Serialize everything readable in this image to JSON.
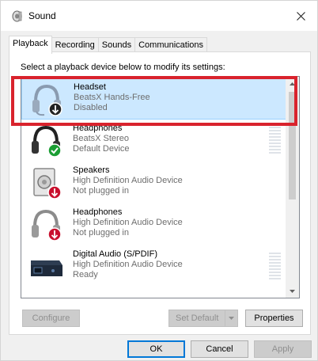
{
  "window": {
    "title": "Sound",
    "icon": "speaker-icon"
  },
  "tabs": [
    {
      "label": "Playback",
      "active": true
    },
    {
      "label": "Recording",
      "active": false
    },
    {
      "label": "Sounds",
      "active": false
    },
    {
      "label": "Communications",
      "active": false
    }
  ],
  "instructions": "Select a playback device below to modify its settings:",
  "devices": [
    {
      "name": "Headset",
      "line1": "BeatsX Hands-Free",
      "line2": "Disabled",
      "icon": "headset-icon",
      "badge": "down-arrow-badge",
      "selected": true,
      "meter": false
    },
    {
      "name": "Headphones",
      "line1": "BeatsX Stereo",
      "line2": "Default Device",
      "icon": "headphones-icon",
      "badge": "checkmark-badge",
      "selected": false,
      "meter": true
    },
    {
      "name": "Speakers",
      "line1": "High Definition Audio Device",
      "line2": "Not plugged in",
      "icon": "speaker-box-icon",
      "badge": "down-arrow-badge",
      "selected": false,
      "meter": false
    },
    {
      "name": "Headphones",
      "line1": "High Definition Audio Device",
      "line2": "Not plugged in",
      "icon": "headphones-icon",
      "badge": "down-arrow-badge",
      "selected": false,
      "meter": false
    },
    {
      "name": "Digital Audio (S/PDIF)",
      "line1": "High Definition Audio Device",
      "line2": "Ready",
      "icon": "digital-audio-icon",
      "badge": "",
      "selected": false,
      "meter": true
    }
  ],
  "buttons": {
    "configure": "Configure",
    "set_default": "Set Default",
    "properties": "Properties",
    "ok": "OK",
    "cancel": "Cancel",
    "apply": "Apply"
  },
  "colors": {
    "selection": "#cce8ff",
    "highlight_border": "#d9232d",
    "default_check": "#1a9e33",
    "badge_dark": "#222222"
  }
}
